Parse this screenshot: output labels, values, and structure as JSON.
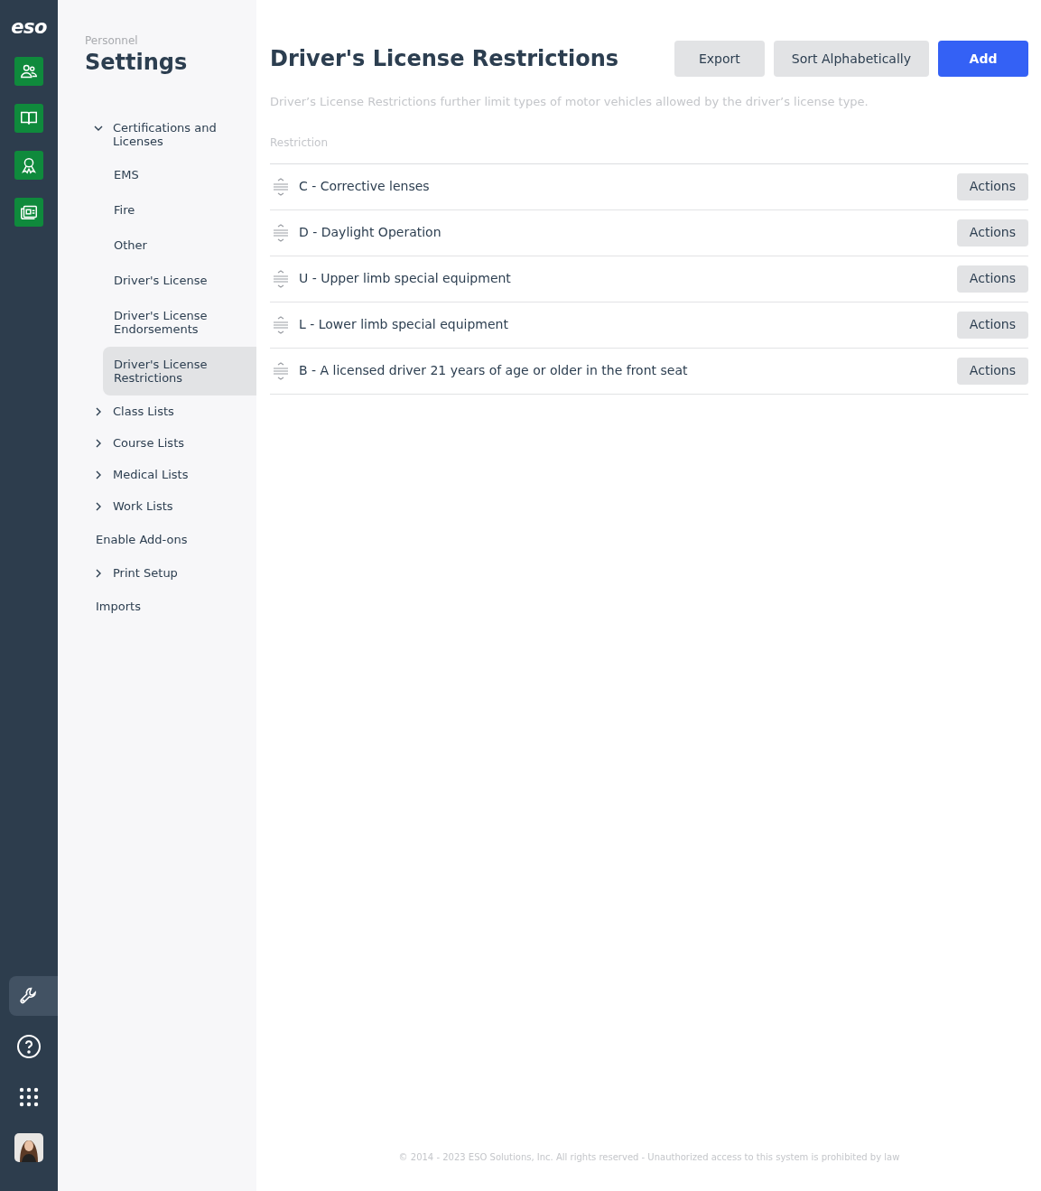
{
  "rail": {
    "logo": "eso",
    "apps": [
      {
        "kind": "people"
      },
      {
        "kind": "book"
      },
      {
        "kind": "award"
      },
      {
        "kind": "news"
      }
    ],
    "tools": [
      {
        "kind": "wrench",
        "selected": true
      },
      {
        "kind": "help",
        "selected": false
      },
      {
        "kind": "apps",
        "selected": false
      },
      {
        "kind": "avatar",
        "selected": false
      }
    ]
  },
  "sidebar": {
    "eyebrow": "Personnel",
    "title": "Settings",
    "items": [
      {
        "kind": "group",
        "label": "Certifications and Licenses",
        "expanded": true,
        "children": [
          {
            "label": "EMS",
            "selected": false
          },
          {
            "label": "Fire",
            "selected": false
          },
          {
            "label": "Other",
            "selected": false
          },
          {
            "label": "Driver's License",
            "selected": false
          },
          {
            "label": "Driver's License Endorsements",
            "selected": false
          },
          {
            "label": "Driver's License Restrictions",
            "selected": true
          }
        ]
      },
      {
        "kind": "group",
        "label": "Class Lists",
        "expanded": false
      },
      {
        "kind": "group",
        "label": "Course Lists",
        "expanded": false
      },
      {
        "kind": "group",
        "label": "Medical Lists",
        "expanded": false
      },
      {
        "kind": "group",
        "label": "Work Lists",
        "expanded": false
      },
      {
        "kind": "link",
        "label": "Enable Add-ons"
      },
      {
        "kind": "group",
        "label": "Print Setup",
        "expanded": false
      },
      {
        "kind": "link",
        "label": "Imports"
      }
    ]
  },
  "page": {
    "title": "Driver's License Restrictions",
    "buttons": [
      {
        "label": "Export",
        "kind": "secondary"
      },
      {
        "label": "Sort Alphabetically",
        "kind": "secondary"
      },
      {
        "label": "Add",
        "kind": "primary"
      }
    ],
    "description": "Driver’s License Restrictions further limit types of motor vehicles allowed by the driver’s license type.",
    "table": {
      "columns": [
        "Restriction"
      ],
      "rows": [
        {
          "name": "C - Corrective lenses",
          "action": "Actions"
        },
        {
          "name": "D - Daylight Operation",
          "action": "Actions"
        },
        {
          "name": "U - Upper limb special equipment",
          "action": "Actions"
        },
        {
          "name": "L - Lower limb special equipment",
          "action": "Actions"
        },
        {
          "name": "B - A licensed driver 21 years of age or older in the front seat",
          "action": "Actions"
        }
      ]
    }
  },
  "footer": "© 2014 - 2023 ESO Solutions, Inc. All rights reserved - Unauthorized access to this system is prohibited by law"
}
